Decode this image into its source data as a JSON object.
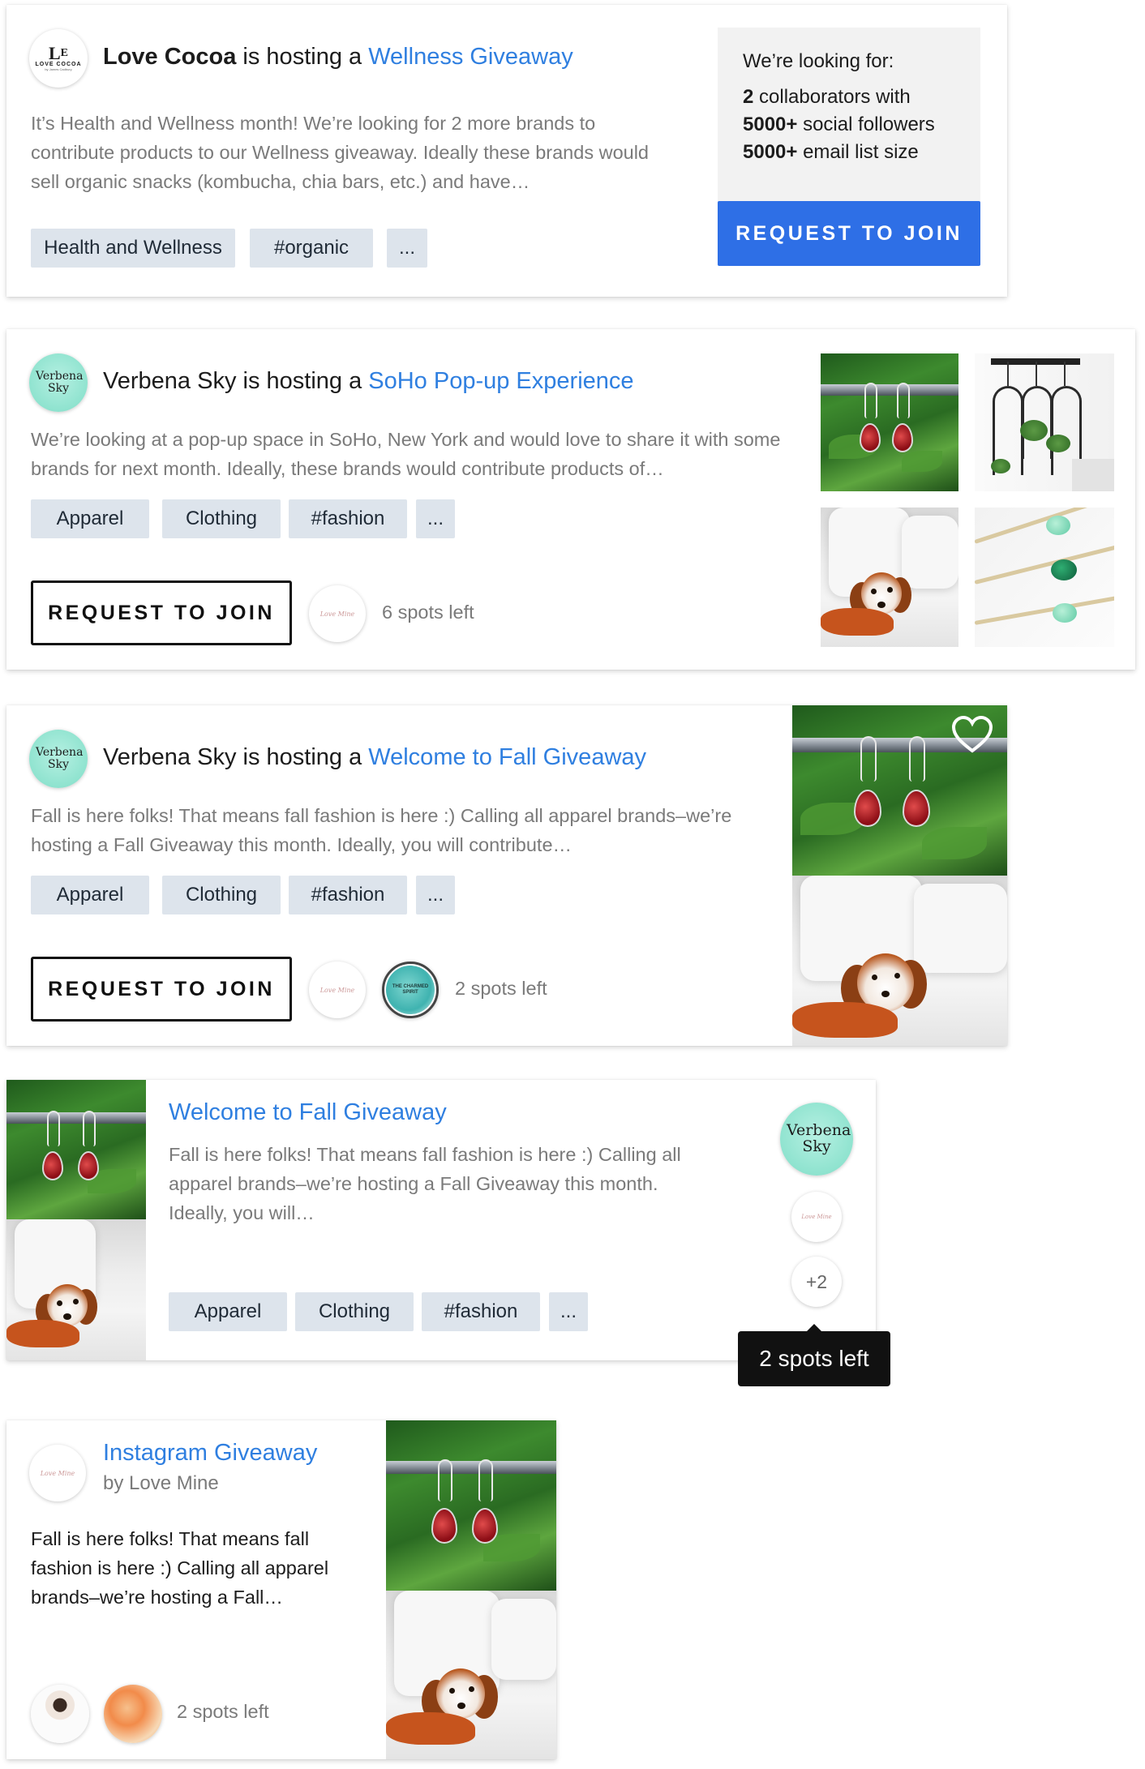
{
  "card1": {
    "host": "Love Cocoa",
    "hosting_text": " is hosting a ",
    "event": "Wellness Giveaway",
    "avatar_logo": "LOVE COCOA",
    "avatar_sub": "by James Cadbury",
    "description": "It’s Health and Wellness month! We’re looking for 2 more brands to contribute products to our Wellness giveaway. Ideally these brands would sell organic snacks (kombucha, chia bars, etc.) and have…",
    "tags": [
      "Health and Wellness",
      "#organic",
      "..."
    ],
    "looking_for_title": "We’re looking for:",
    "req1_num": "2",
    "req1_text": " collaborators with",
    "req2_num": "5000+",
    "req2_text": " social followers",
    "req3_num": "5000+",
    "req3_text": " email list size",
    "button": "REQUEST TO JOIN"
  },
  "card2": {
    "avatar": "Verbena Sky",
    "host_text": "Verbena Sky is hosting a ",
    "event": "SoHo Pop-up Experience",
    "description": "We’re looking at a pop-up space in SoHo, New York and would love to share it with some brands for next month. Ideally,  these brands would contribute products of…",
    "tags": [
      "Apparel",
      "Clothing",
      "#fashion",
      "..."
    ],
    "button": "REQUEST TO JOIN",
    "participant_logo": "Love Mine",
    "spots": "6 spots left"
  },
  "card3": {
    "avatar": "Verbena Sky",
    "host_text": "Verbena Sky is hosting a ",
    "event": "Welcome to Fall Giveaway",
    "description": "Fall is here folks! That means fall fashion is here :) Calling all apparel brands–we’re hosting a Fall Giveaway this month. Ideally, you will contribute…",
    "tags": [
      "Apparel",
      "Clothing",
      "#fashion",
      "..."
    ],
    "button": "REQUEST TO JOIN",
    "participant_logo": "Love Mine",
    "participant2_logo": "THE CHARMED SPIRIT",
    "spots": "2 spots left"
  },
  "card4": {
    "title": "Welcome to Fall Giveaway",
    "description": "Fall is here folks! That means fall fashion is here :) Calling all apparel brands–we’re hosting a Fall Giveaway this month. Ideally, you will…",
    "tags": [
      "Apparel",
      "Clothing",
      "#fashion",
      "..."
    ],
    "host_avatar": "Verbena Sky",
    "participant_logo": "Love Mine",
    "more_count": "+2",
    "tooltip": "2 spots left"
  },
  "card5": {
    "title": "Instagram Giveaway",
    "by": "by Love Mine",
    "avatar_logo": "Love Mine",
    "description": "Fall is here folks! That means fall fashion is here :) Calling all apparel brands–we’re hosting a Fall…",
    "spots": "2 spots left"
  },
  "colors": {
    "link": "#2f7fe0",
    "primary_button": "#2e6fe6",
    "tag_bg": "#dde4ec",
    "mint_avatar": "#8fe3cf",
    "panel_bg": "#f2f2f2",
    "tooltip_bg": "#111111"
  },
  "icons": [
    "heart-icon"
  ]
}
